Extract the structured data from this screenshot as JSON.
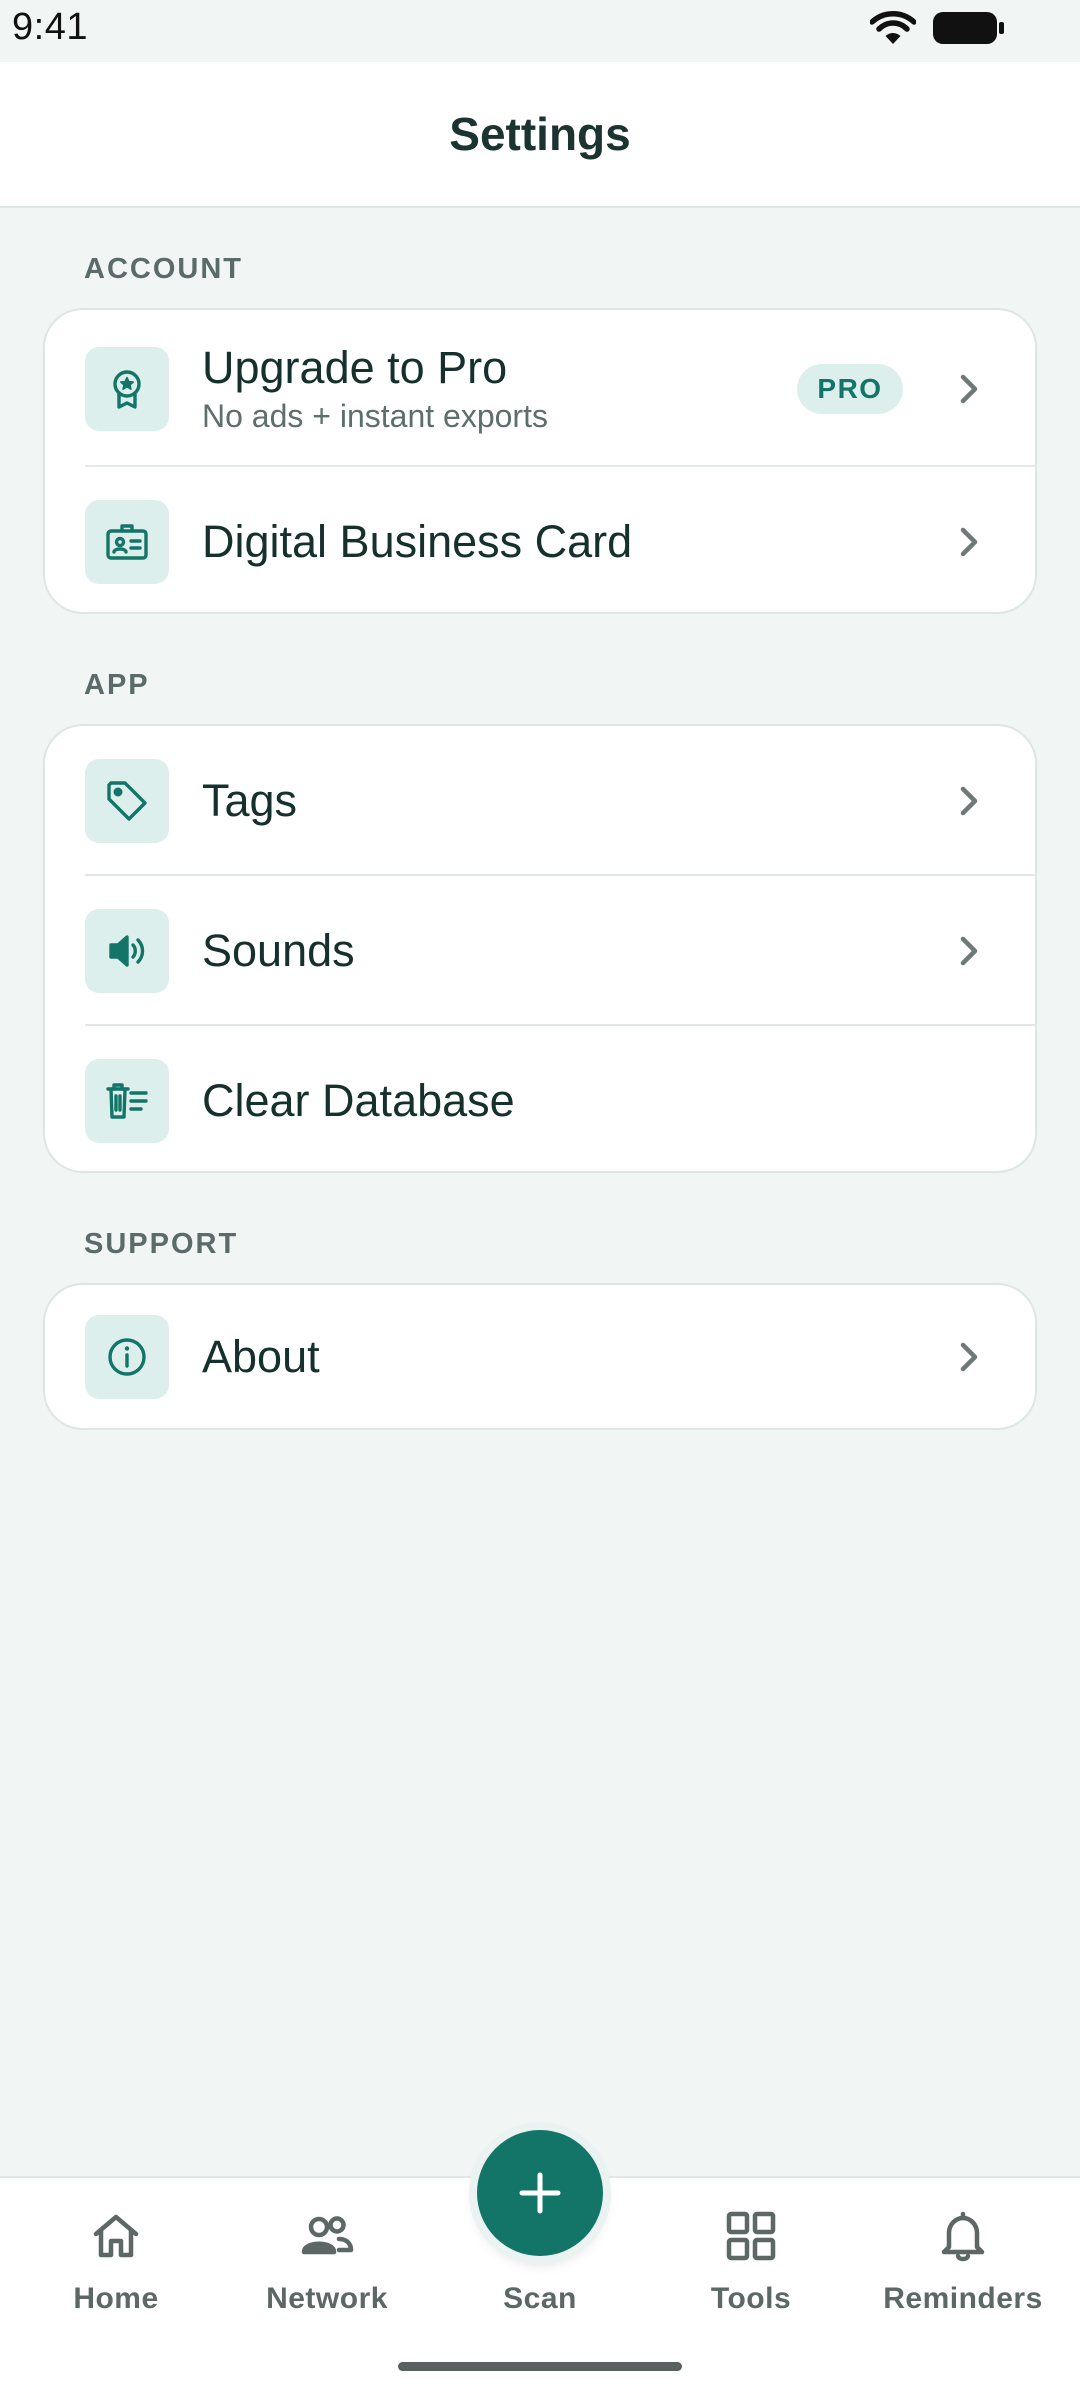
{
  "status_bar": {
    "time": "9:41",
    "icons": [
      "wifi-icon",
      "battery-icon"
    ]
  },
  "app_bar": {
    "title": "Settings"
  },
  "sections": {
    "account": {
      "label": "ACCOUNT",
      "items": [
        {
          "icon": "award-icon",
          "title": "Upgrade to Pro",
          "subtitle": "No ads + instant exports",
          "badge": "PRO",
          "chevron": true
        },
        {
          "icon": "id-card-icon",
          "title": "Digital Business Card",
          "chevron": true
        }
      ]
    },
    "app": {
      "label": "APP",
      "items": [
        {
          "icon": "tag-icon",
          "title": "Tags",
          "chevron": true
        },
        {
          "icon": "volume-icon",
          "title": "Sounds",
          "chevron": true
        },
        {
          "icon": "clear-database-icon",
          "title": "Clear Database",
          "chevron": false
        }
      ]
    },
    "support": {
      "label": "SUPPORT",
      "items": [
        {
          "icon": "info-icon",
          "title": "About",
          "chevron": true
        }
      ]
    }
  },
  "bottom_nav": {
    "items": [
      {
        "icon": "home-icon",
        "label": "Home"
      },
      {
        "icon": "people-icon",
        "label": "Network"
      },
      {
        "icon": "plus-icon",
        "label": "Scan"
      },
      {
        "icon": "grid-icon",
        "label": "Tools"
      },
      {
        "icon": "bell-icon",
        "label": "Reminders"
      }
    ]
  },
  "colors": {
    "accent": "#137567",
    "icon_tile_bg": "#dcefec",
    "page_bg": "#f1f5f4",
    "card_bg": "#ffffff",
    "title_text": "#16302d",
    "muted_text": "#5d6e6c"
  }
}
